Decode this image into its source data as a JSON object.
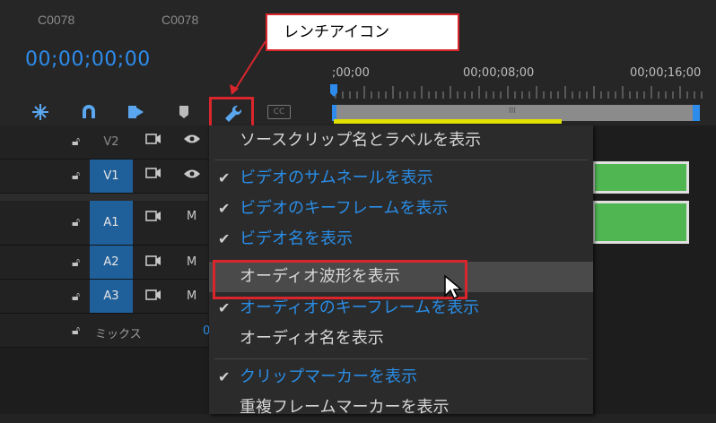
{
  "header": {
    "clip_names": [
      "C0078",
      "C0078"
    ],
    "timecode": "00;00;00;00"
  },
  "toolbar": {
    "tools": [
      "snap-icon",
      "magnet-icon",
      "linked-selection-icon",
      "marker-icon",
      "wrench-icon",
      "captions-icon"
    ],
    "captions_label": "CC"
  },
  "ruler": {
    "labels": [
      ";00;00",
      "00;00;08;00",
      "00;00;16;00"
    ],
    "work_area_label": "III"
  },
  "tracks": [
    {
      "name": "V2",
      "selected": false,
      "toggle": "eye-icon"
    },
    {
      "name": "V1",
      "selected": true,
      "toggle": "eye-icon"
    },
    {
      "name": "A1",
      "selected": true,
      "toggle": "M"
    },
    {
      "name": "A2",
      "selected": true,
      "toggle": "M"
    },
    {
      "name": "A3",
      "selected": true,
      "toggle": "M"
    }
  ],
  "mix_label": "ミックス",
  "mix_value_partial": "0",
  "context_menu": {
    "items": [
      {
        "label": "ソースクリップ名とラベルを表示",
        "checked": false,
        "enabled": true
      },
      {
        "label": "ビデオのサムネールを表示",
        "checked": true,
        "enabled": true
      },
      {
        "label": "ビデオのキーフレームを表示",
        "checked": true,
        "enabled": true
      },
      {
        "label": "ビデオ名を表示",
        "checked": true,
        "enabled": true
      },
      {
        "label": "オーディオ波形を表示",
        "checked": false,
        "enabled": true,
        "hovered": true
      },
      {
        "label": "オーディオのキーフレームを表示",
        "checked": true,
        "enabled": true
      },
      {
        "label": "オーディオ名を表示",
        "checked": false,
        "enabled": true
      },
      {
        "label": "クリップマーカーを表示",
        "checked": true,
        "enabled": true
      },
      {
        "label": "重複フレームマーカーを表示",
        "checked": false,
        "enabled": true
      }
    ]
  },
  "callout": {
    "text": "レンチアイコン"
  },
  "colors": {
    "accent_blue": "#2a8de6",
    "highlight_red": "#d9262c",
    "clip_green": "#4fb652",
    "track_selected": "#1f5f9a"
  }
}
